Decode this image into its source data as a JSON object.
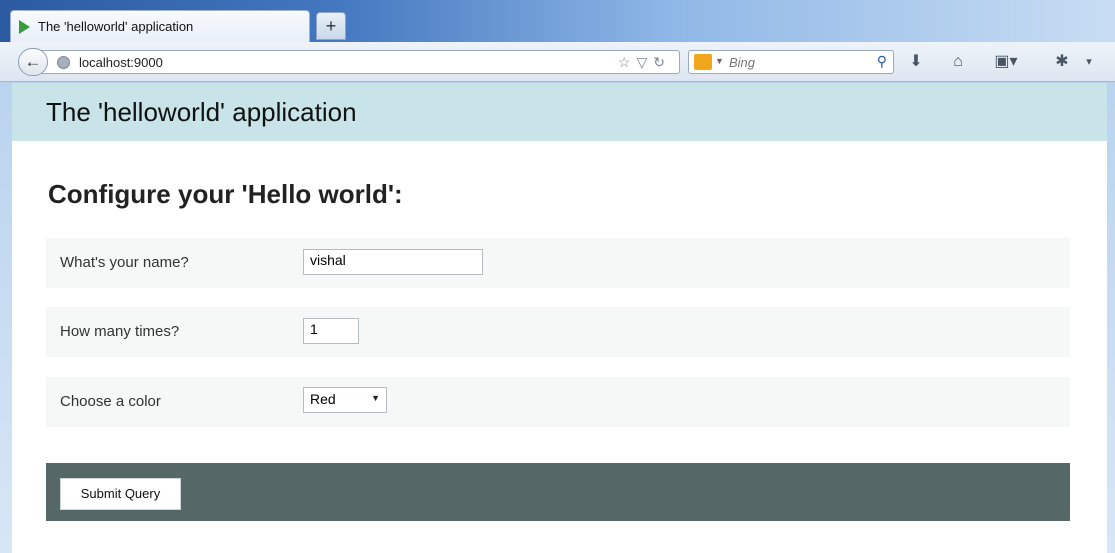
{
  "browser": {
    "tab_title": "The 'helloworld' application",
    "new_tab_label": "+",
    "url": "localhost:9000",
    "search_engine": "Bing",
    "icons": [
      "back-icon",
      "globe-icon",
      "bookmark-star-icon",
      "dropdown-icon",
      "reload-icon",
      "bing-icon",
      "search-icon",
      "download-icon",
      "home-icon",
      "bookmarks-menu-icon",
      "addon-icon",
      "menu-icon"
    ]
  },
  "page": {
    "header_title": "The 'helloworld' application",
    "heading": "Configure your 'Hello world':",
    "form": {
      "name_label": "What's your name?",
      "name_value": "vishal",
      "times_label": "How many times?",
      "times_value": "1",
      "color_label": "Choose a color",
      "color_value": "Red"
    },
    "submit_label": "Submit Query"
  },
  "colors": {
    "header_bg": "#c8e4e8",
    "row_bg": "#f6f7f7",
    "actions_bg": "#566767"
  }
}
